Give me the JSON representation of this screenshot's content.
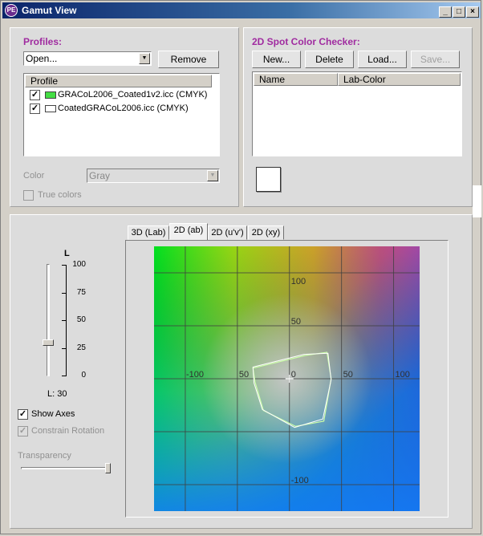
{
  "window": {
    "title": "Gamut View",
    "icon": "gamut-app-icon",
    "minimize": "_",
    "maximize": "□",
    "close": "×"
  },
  "profiles": {
    "label": "Profiles:",
    "open_value": "Open...",
    "remove_label": "Remove",
    "list_header": "Profile",
    "items": [
      {
        "name": "GRACoL2006_Coated1v2.icc (CMYK)",
        "checked": true,
        "color": "#44dd44"
      },
      {
        "name": "CoatedGRACoL2006.icc (CMYK)",
        "checked": true,
        "color": "#ffffff"
      }
    ],
    "color_label": "Color",
    "color_value": "Gray",
    "true_colors_label": "True colors"
  },
  "spot": {
    "label": "2D Spot Color Checker:",
    "new_label": "New...",
    "delete_label": "Delete",
    "load_label": "Load...",
    "save_label": "Save...",
    "col_name": "Name",
    "col_lab": "Lab-Color",
    "swatch_color": "#ffffff"
  },
  "view": {
    "l_label": "L",
    "l_ticks": [
      "100",
      "75",
      "50",
      "25",
      "0"
    ],
    "l_value_text": "L: 30",
    "l_value": 30,
    "show_axes_label": "Show Axes",
    "show_axes_checked": true,
    "constrain_label": "Constrain Rotation",
    "transparency_label": "Transparency",
    "transparency_value": 1.0,
    "tabs": [
      "3D (Lab)",
      "2D (ab)",
      "2D (u'v')",
      "2D (xy)"
    ],
    "active_tab": "2D (ab)",
    "plot": {
      "b_labels": {
        "p100": "100",
        "p50": "50",
        "zero": "0",
        "m100": "-100"
      },
      "a_labels": {
        "m100": "-100",
        "m50": "50",
        "p50": "50",
        "p100": "100"
      },
      "a_range": [
        -130,
        125
      ],
      "b_range": [
        -125,
        125
      ],
      "gamut_gracol": [
        [
          -35,
          10
        ],
        [
          15,
          22
        ],
        [
          36,
          25
        ],
        [
          40,
          0
        ],
        [
          33,
          -40
        ],
        [
          6,
          -45
        ],
        [
          -25,
          -30
        ],
        [
          -33,
          -3
        ]
      ],
      "gamut_coated": [
        [
          -35,
          11
        ],
        [
          14,
          23
        ],
        [
          37,
          24
        ],
        [
          40,
          -1
        ],
        [
          32,
          -38
        ],
        [
          5,
          -46
        ],
        [
          -26,
          -29
        ],
        [
          -34,
          -4
        ]
      ],
      "gracol_color": "#ccffaa",
      "coated_color": "#ffffff"
    }
  }
}
